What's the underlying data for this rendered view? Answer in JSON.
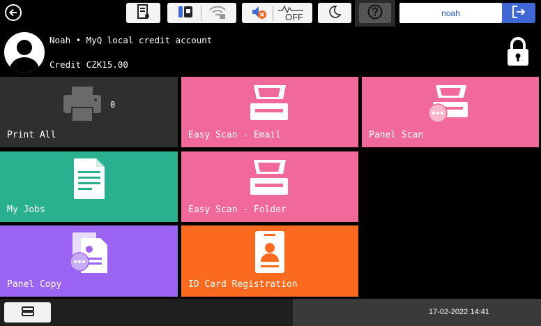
{
  "topbar": {
    "username": "noah",
    "icons": [
      "back-arrow-icon",
      "toner-icon",
      "usb-icon",
      "wifi-off-icon",
      "sound-muted-icon",
      "network-off-icon",
      "sleep-moon-icon",
      "help-icon",
      "logout-icon"
    ],
    "network_off_label": "OFF"
  },
  "header": {
    "account": "Noah • MyQ local credit account",
    "credit": "Credit CZK15.00"
  },
  "tiles": [
    {
      "label": "Print All",
      "badge": "0",
      "color": "#2f2f2f"
    },
    {
      "label": "Easy Scan - Email",
      "color": "#f0699a"
    },
    {
      "label": "Panel Scan",
      "color": "#f0699a"
    },
    {
      "label": "My Jobs",
      "color": "#29b08e"
    },
    {
      "label": "Easy Scan - Folder",
      "color": "#f0699a"
    },
    {
      "label": "Panel Copy",
      "color": "#9c64f2"
    },
    {
      "label": "ID Card Registration",
      "color": "#fb6a1f"
    }
  ],
  "bottombar": {
    "datetime": "17-02-2022 14:41"
  }
}
